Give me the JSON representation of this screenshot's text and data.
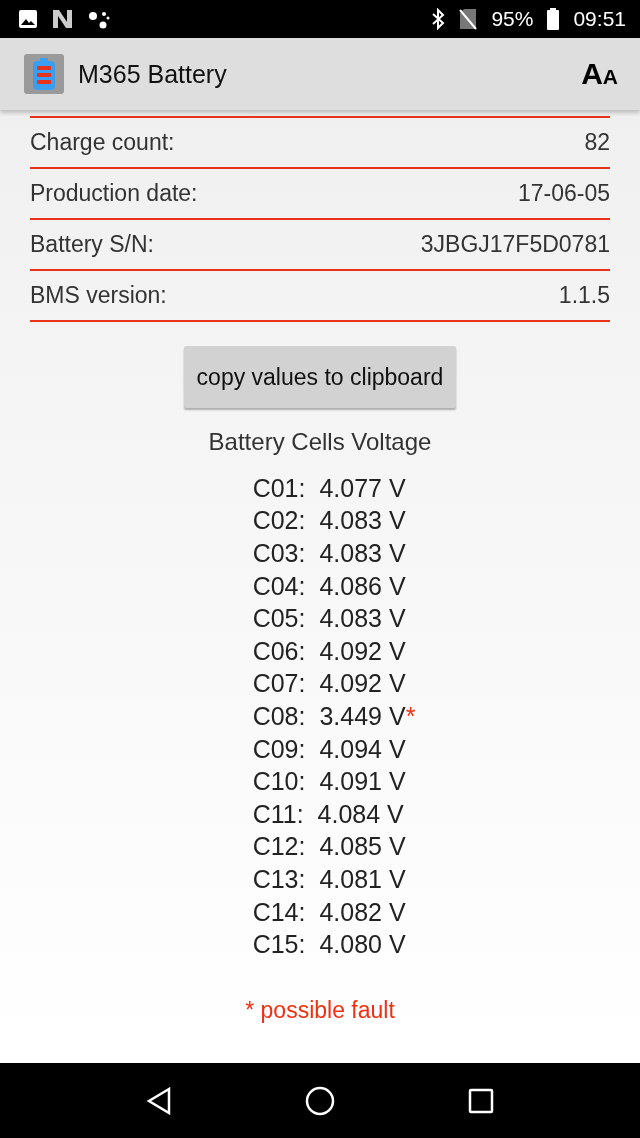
{
  "status_bar": {
    "battery": "95%",
    "time": "09:51"
  },
  "app_bar": {
    "title": "M365 Battery",
    "font_button": {
      "large": "A",
      "small": "A"
    }
  },
  "info_rows": [
    {
      "label": "Charge count:",
      "value": "82"
    },
    {
      "label": "Production date:",
      "value": "17-06-05"
    },
    {
      "label": "Battery S/N:",
      "value": "3JBGJ17F5D0781"
    },
    {
      "label": "BMS version:",
      "value": "1.1.5"
    }
  ],
  "copy_button": "copy values to clipboard",
  "cells_title": "Battery Cells Voltage",
  "cells": [
    {
      "name": "C01:",
      "voltage": "4.077 V"
    },
    {
      "name": "C02:",
      "voltage": "4.083 V"
    },
    {
      "name": "C03:",
      "voltage": "4.083 V"
    },
    {
      "name": "C04:",
      "voltage": "4.086 V"
    },
    {
      "name": "C05:",
      "voltage": "4.083 V"
    },
    {
      "name": "C06:",
      "voltage": "4.092 V"
    },
    {
      "name": "C07:",
      "voltage": "4.092 V"
    },
    {
      "name": "C08:",
      "voltage": "3.449 V",
      "note": "*"
    },
    {
      "name": "C09:",
      "voltage": "4.094 V"
    },
    {
      "name": "C10:",
      "voltage": "4.091 V"
    },
    {
      "name": "C11:",
      "voltage": "4.084 V"
    },
    {
      "name": "C12:",
      "voltage": "4.085 V"
    },
    {
      "name": "C13:",
      "voltage": "4.081 V"
    },
    {
      "name": "C14:",
      "voltage": "4.082 V"
    },
    {
      "name": "C15:",
      "voltage": "4.080 V"
    }
  ],
  "footnote": "* possible fault"
}
